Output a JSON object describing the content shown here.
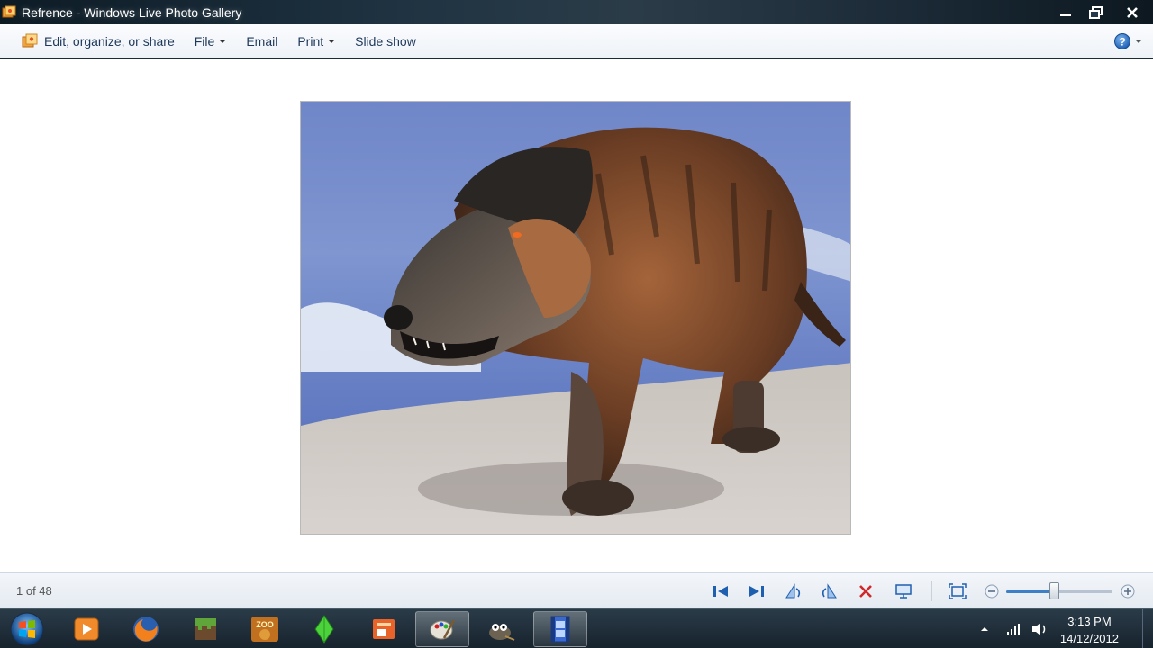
{
  "window": {
    "title": "Refrence - Windows Live Photo Gallery"
  },
  "menu": {
    "items": [
      {
        "label": "Edit, organize, or share",
        "icon": "photo-gallery-icon"
      },
      {
        "label": "File",
        "has_dropdown": true
      },
      {
        "label": "Email",
        "has_dropdown": false
      },
      {
        "label": "Print",
        "has_dropdown": true
      },
      {
        "label": "Slide show",
        "has_dropdown": false
      }
    ],
    "help_icon": "help-icon"
  },
  "viewer": {
    "photo_subject": "prehistoric predator on beach"
  },
  "status": {
    "counter": "1 of 48",
    "zoom_level": 0.45,
    "controls": [
      "previous-icon",
      "next-icon",
      "rotate-left-icon",
      "rotate-right-icon",
      "delete-icon",
      "slideshow-icon",
      "fit-window-icon",
      "zoom-out-icon",
      "zoom-in-icon"
    ]
  },
  "taskbar": {
    "apps": [
      "media-player-icon",
      "firefox-icon",
      "minecraft-icon",
      "zoo-tycoon-icon",
      "sims-icon",
      "office-icon",
      "paint-icon",
      "gimp-icon",
      "movie-maker-icon"
    ],
    "clock_time": "3:13 PM",
    "clock_date": "14/12/2012"
  },
  "colors": {
    "menu_text": "#1e395b",
    "accent_blue": "#1f5fb0",
    "delete_red": "#d0282a"
  }
}
